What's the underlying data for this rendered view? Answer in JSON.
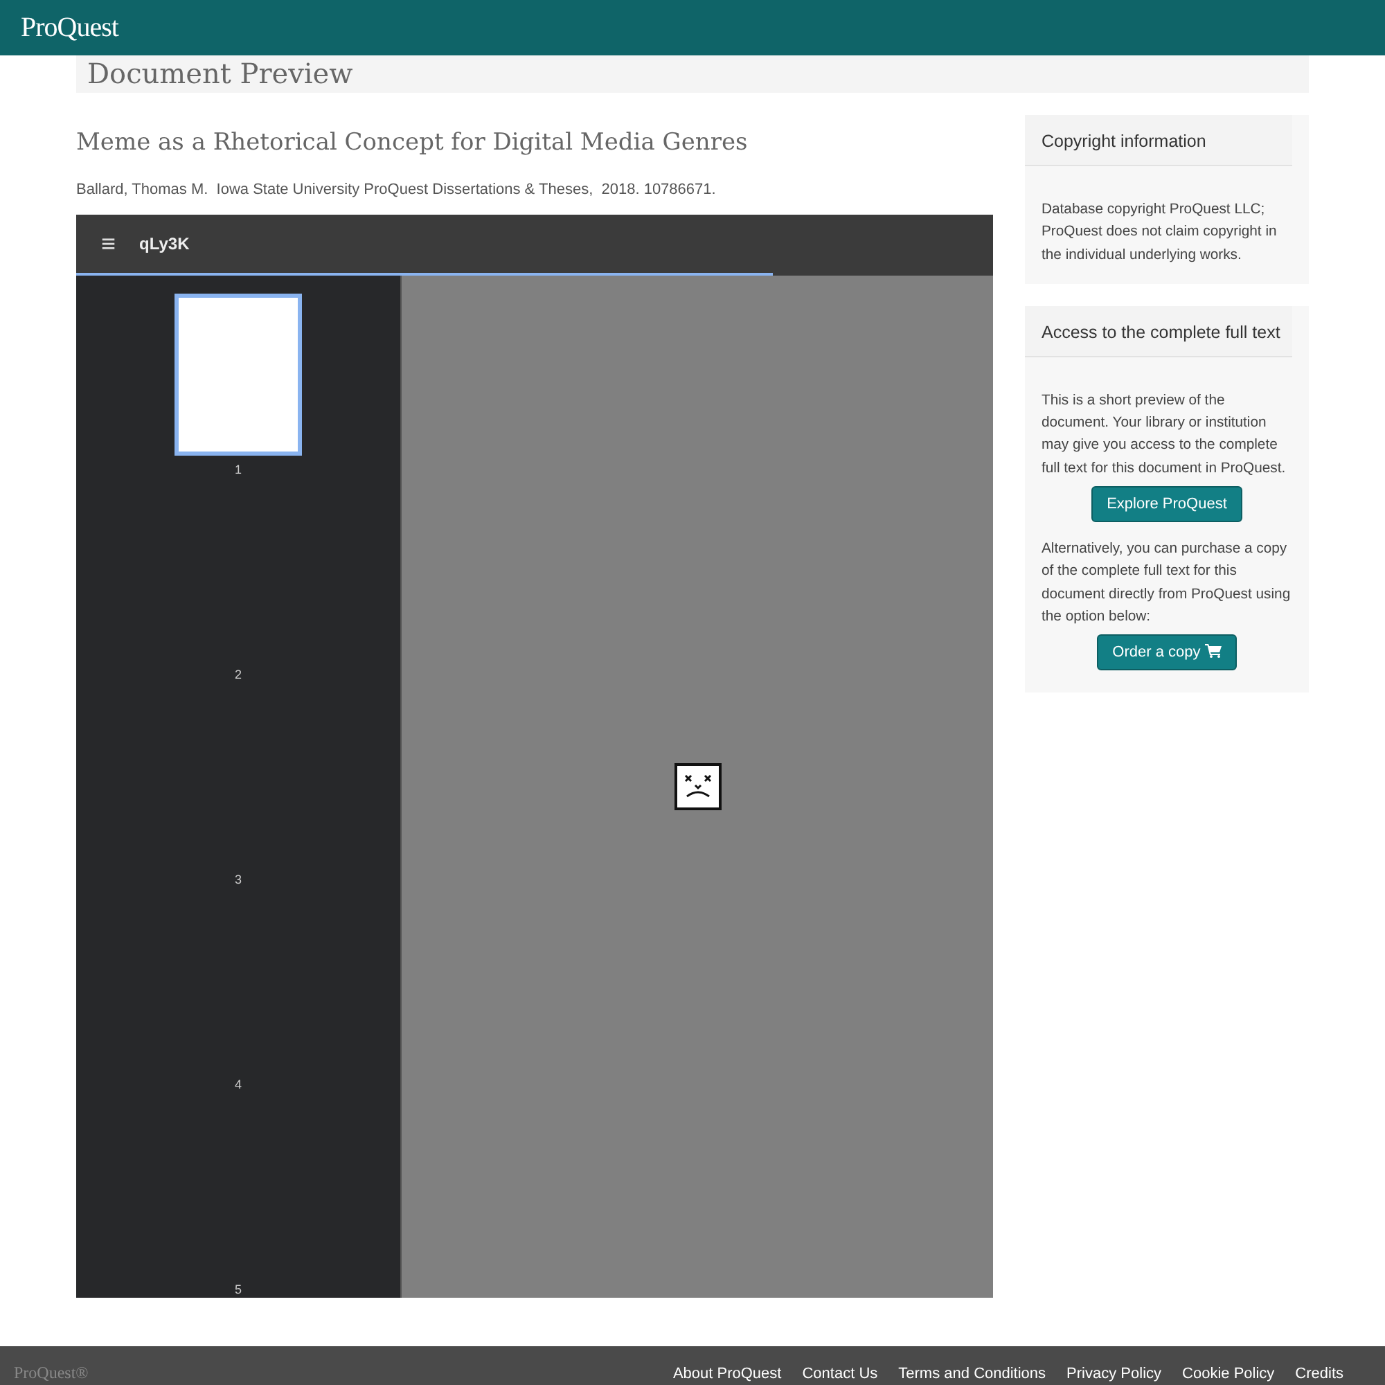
{
  "header": {
    "logo": "ProQuest"
  },
  "page_title": "Document Preview",
  "document": {
    "title": "Meme as a Rhetorical Concept for Digital Media Genres",
    "citation": "Ballard, Thomas M.  Iowa State University ProQuest Dissertations & Theses,  2018. 10786671."
  },
  "viewer": {
    "menu_icon": "≡",
    "file_name": "qLy3K",
    "loading": {
      "level": 0.76
    },
    "pages": [
      {
        "number": "1",
        "selected": true
      },
      {
        "number": "2",
        "selected": false
      },
      {
        "number": "3",
        "selected": false
      },
      {
        "number": "4",
        "selected": false
      },
      {
        "number": "5",
        "selected": false
      }
    ]
  },
  "sidebar": [
    {
      "title": "Copyright information",
      "blocks": [
        {
          "kind": "text",
          "text": "Database copyright ProQuest LLC; ProQuest does not claim copyright in the individual underlying works."
        }
      ]
    },
    {
      "title": "Access to the complete full text",
      "blocks": [
        {
          "kind": "text",
          "text": "This is a short preview of the document. Your library or institution may give you access to the complete full text for this document in ProQuest."
        },
        {
          "kind": "button",
          "label": "Explore ProQuest"
        },
        {
          "kind": "text",
          "text": "Alternatively, you can purchase a copy of the complete full text for this document directly from ProQuest using the option below:"
        },
        {
          "kind": "cart_button",
          "label": "Order a copy"
        }
      ]
    }
  ],
  "footer": {
    "logo": "ProQuest®",
    "links": [
      "About ProQuest",
      "Contact Us",
      "Terms and Conditions",
      "Privacy Policy",
      "Cookie Policy",
      "Credits"
    ]
  }
}
